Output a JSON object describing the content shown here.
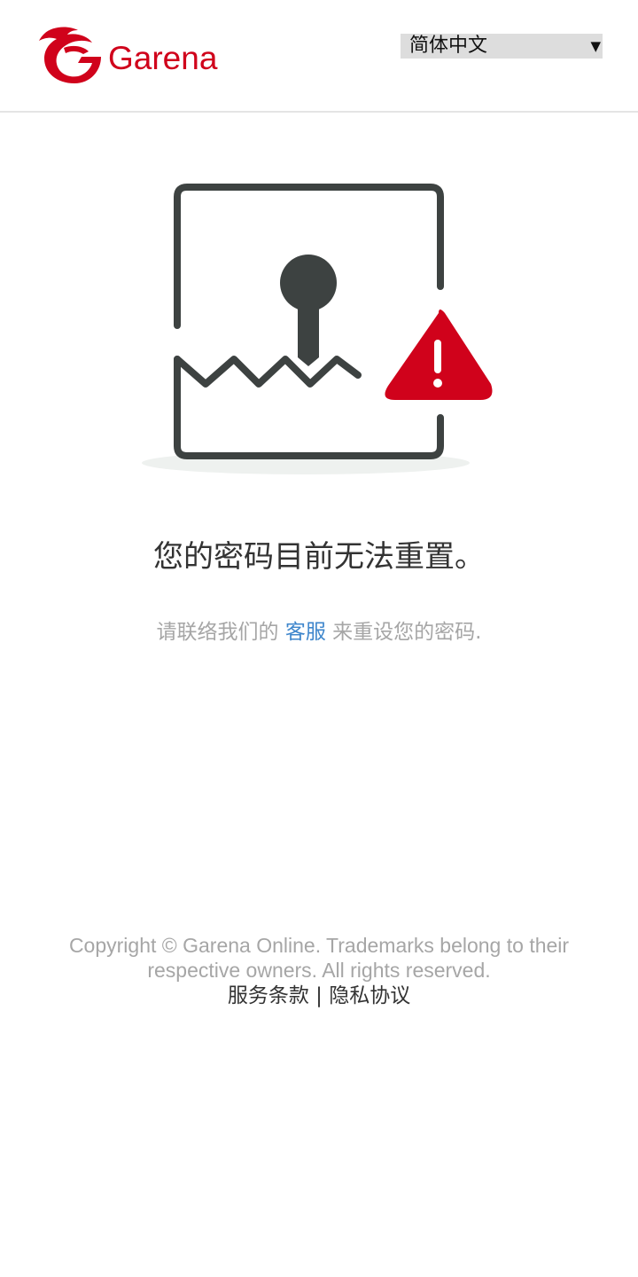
{
  "header": {
    "logo_text": "Garena",
    "language_select": {
      "selected": "简体中文"
    }
  },
  "main": {
    "title": "您的密码目前无法重置。",
    "message_before": "请联络我们的",
    "support_link": "客服",
    "message_after": "来重设您的密码."
  },
  "footer": {
    "copyright": "Copyright © Garena Online. Trademarks belong to their respective owners. All rights reserved.",
    "terms_link": "服务条款",
    "separator": "|",
    "privacy_link": "隐私协议"
  },
  "colors": {
    "brand_red": "#d0021b",
    "link_blue": "#3e86cc",
    "icon_dark": "#3d4241",
    "muted_text": "#a6a6a6"
  },
  "icons": {
    "logo": "garena-dragon-logo",
    "illustration": "broken-lock-warning-icon",
    "warning": "warning-triangle-icon",
    "dropdown": "caret-down-icon"
  }
}
